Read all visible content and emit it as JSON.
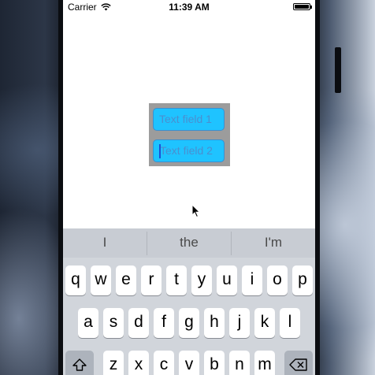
{
  "status_bar": {
    "carrier": "Carrier",
    "time": "11:39 AM"
  },
  "text_fields": [
    {
      "placeholder": "Text field 1",
      "value": "",
      "focused": false
    },
    {
      "placeholder": "Text field 2",
      "value": "",
      "focused": true
    }
  ],
  "colors": {
    "field_background": "#1fc3ff",
    "container_background": "#9c9c9c",
    "keyboard_background": "#d1d5db"
  },
  "keyboard": {
    "predictions": [
      "I",
      "the",
      "I'm"
    ],
    "row1": [
      "q",
      "w",
      "e",
      "r",
      "t",
      "y",
      "u",
      "i",
      "o",
      "p"
    ],
    "row2": [
      "a",
      "s",
      "d",
      "f",
      "g",
      "h",
      "j",
      "k",
      "l"
    ],
    "row3": [
      "z",
      "x",
      "c",
      "v",
      "b",
      "n",
      "m"
    ],
    "icons": {
      "shift": "shift-icon",
      "delete": "delete-icon"
    }
  }
}
